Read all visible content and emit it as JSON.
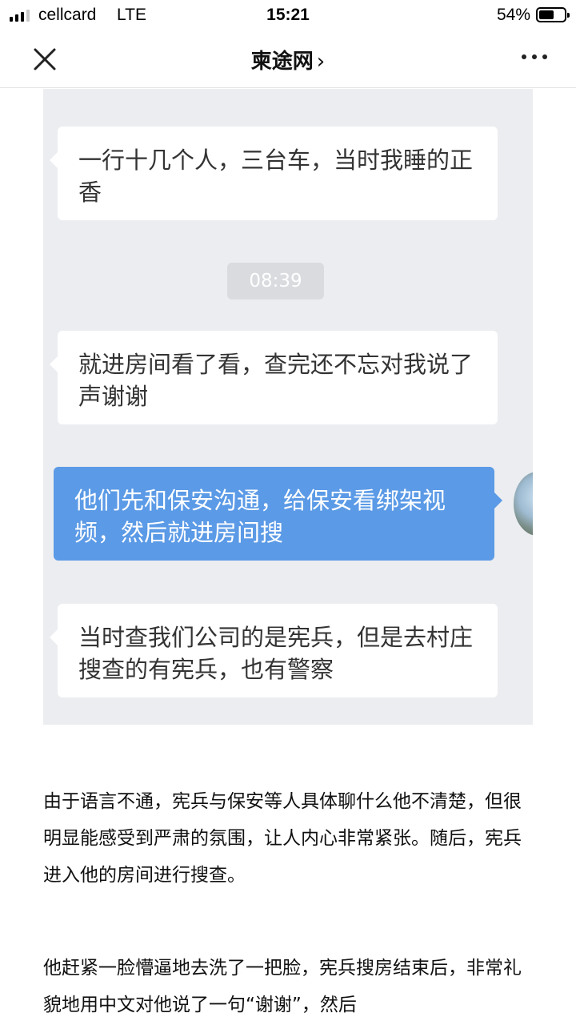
{
  "status_bar": {
    "carrier": "cellcard",
    "network": "LTE",
    "time": "15:21",
    "battery_percent": "54%"
  },
  "nav": {
    "title": "柬途网",
    "chevron": "›",
    "close_icon": "close-icon",
    "more_icon": "more-dots-icon"
  },
  "chat": {
    "messages": [
      {
        "side": "left",
        "text": "一行十几个人，三台车，当时我睡的正香"
      },
      {
        "side": "left",
        "text": "就进房间看了看，查完还不忘对我说了声谢谢"
      },
      {
        "side": "right",
        "text": "他们先和保安沟通，给保安看绑架视频，然后就进房间搜"
      },
      {
        "side": "left",
        "text": "当时查我们公司的是宪兵，但是去村庄搜查的有宪兵，也有警察"
      }
    ],
    "timestamp": "08:39",
    "colors": {
      "background": "#ebedf0",
      "sent_bubble": "#5b9ae6",
      "received_bubble": "#ffffff"
    }
  },
  "article": {
    "paragraphs": [
      "由于语言不通，宪兵与保安等人具体聊什么他不清楚，但很明显能感受到严肃的氛围，让人内心非常紧张。随后，宪兵进入他的房间进行搜查。",
      "他赶紧一脸懵逼地去洗了一把脸，宪兵搜房结束后，非常礼貌地用中文对他说了一句“谢谢”，然后"
    ]
  }
}
